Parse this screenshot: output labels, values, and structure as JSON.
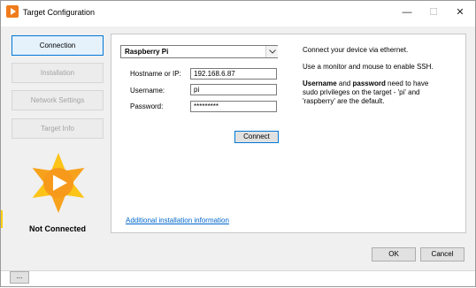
{
  "window": {
    "title": "Target Configuration",
    "minimize_glyph": "—",
    "maximize_glyph": "☐",
    "close_glyph": "✕"
  },
  "nav": {
    "items": [
      {
        "label": "Connection",
        "active": true
      },
      {
        "label": "Installation",
        "active": false
      },
      {
        "label": "Network Settings",
        "active": false
      },
      {
        "label": "Target Info",
        "active": false
      }
    ],
    "status": "Not Connected"
  },
  "form": {
    "device_select": "Raspberry Pi",
    "hostname_label": "Hostname or IP:",
    "hostname_value": "192.168.6.87",
    "username_label": "Username:",
    "username_value": "pi",
    "password_label": "Password:",
    "password_value": "*********",
    "connect_label": "Connect"
  },
  "info": {
    "line1": "Connect your device via ethernet.",
    "line2": "Use a monitor and mouse to enable SSH.",
    "line3_bold1": "Username",
    "line3_mid": " and ",
    "line3_bold2": "password",
    "line3_rest": " need to have",
    "line4": "sudo privileges on the target - 'pi' and",
    "line5": "'raspberry' are the default."
  },
  "link": "Additional installation information",
  "buttons": {
    "ok": "OK",
    "cancel": "Cancel",
    "more": "..."
  },
  "colors": {
    "accent": "#0078d7",
    "logo_orange": "#f79a1c",
    "logo_yellow": "#fcc419",
    "link": "#0066cc"
  },
  "icons": {
    "app": "play-logo-icon",
    "dropdown": "chevron-down-icon"
  }
}
